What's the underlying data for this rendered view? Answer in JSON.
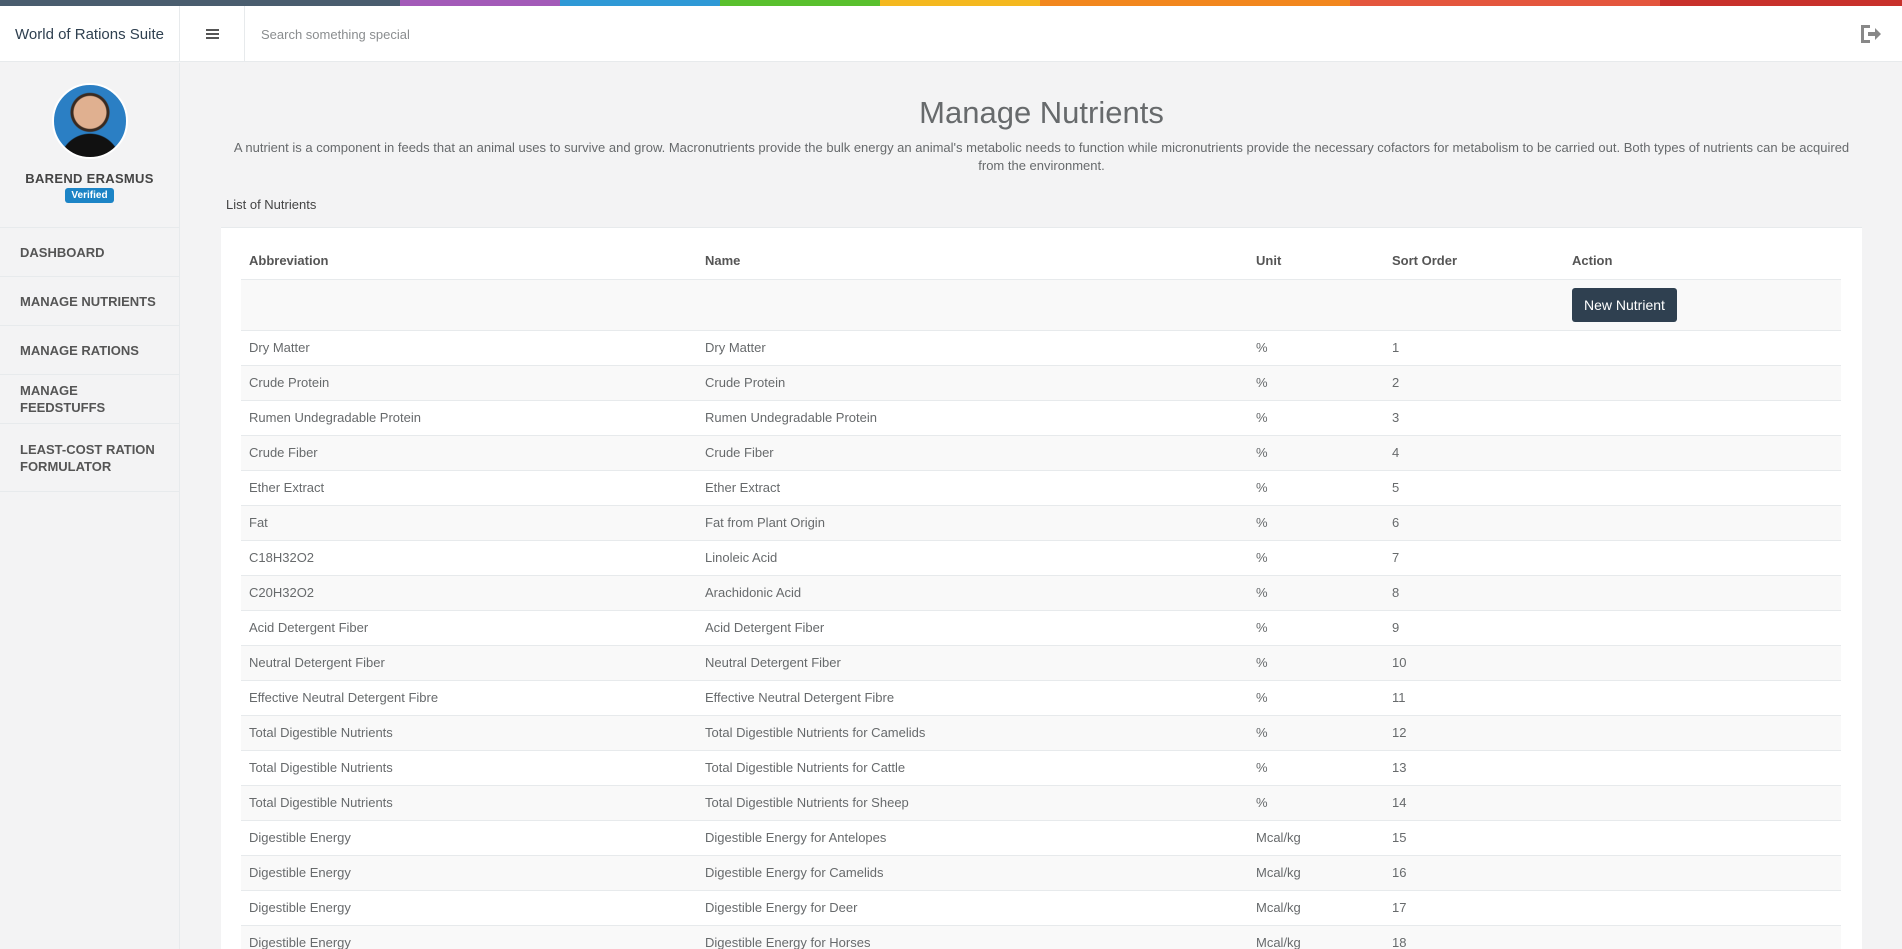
{
  "colorbar": [
    "#4a5d6e",
    "#a35ab8",
    "#2f99d6",
    "#59c02e",
    "#f4b81f",
    "#f2871e",
    "#e4563d",
    "#c8312b"
  ],
  "app": {
    "title": "World of Rations Suite"
  },
  "search": {
    "placeholder": "Search something special"
  },
  "profile": {
    "name": "BAREND ERASMUS",
    "badge": "Verified"
  },
  "nav": [
    {
      "label": "DASHBOARD"
    },
    {
      "label": "MANAGE NUTRIENTS"
    },
    {
      "label": "MANAGE RATIONS"
    },
    {
      "label": "MANAGE FEEDSTUFFS"
    },
    {
      "label": "LEAST-COST RATION FORMULATOR"
    }
  ],
  "page": {
    "title": "Manage Nutrients",
    "description": "A nutrient is a component in feeds that an animal uses to survive and grow. Macronutrients provide the bulk energy an animal's metabolic needs to function while micronutrients provide the necessary cofactors for metabolism to be carried out. Both types of nutrients can be acquired from the environment.",
    "list_label": "List of Nutrients"
  },
  "table": {
    "headers": {
      "abbr": "Abbreviation",
      "name": "Name",
      "unit": "Unit",
      "sort": "Sort Order",
      "action": "Action"
    },
    "new_button": "New Nutrient",
    "rows": [
      {
        "abbr": "Dry Matter",
        "name": "Dry Matter",
        "unit": "%",
        "sort": "1"
      },
      {
        "abbr": "Crude Protein",
        "name": "Crude Protein",
        "unit": "%",
        "sort": "2"
      },
      {
        "abbr": "Rumen Undegradable Protein",
        "name": "Rumen Undegradable Protein",
        "unit": "%",
        "sort": "3"
      },
      {
        "abbr": "Crude Fiber",
        "name": "Crude Fiber",
        "unit": "%",
        "sort": "4"
      },
      {
        "abbr": "Ether Extract",
        "name": "Ether Extract",
        "unit": "%",
        "sort": "5"
      },
      {
        "abbr": "Fat",
        "name": "Fat from Plant Origin",
        "unit": "%",
        "sort": "6"
      },
      {
        "abbr": "C18H32O2",
        "name": "Linoleic Acid",
        "unit": "%",
        "sort": "7"
      },
      {
        "abbr": "C20H32O2",
        "name": "Arachidonic Acid",
        "unit": "%",
        "sort": "8"
      },
      {
        "abbr": "Acid Detergent Fiber",
        "name": "Acid Detergent Fiber",
        "unit": "%",
        "sort": "9"
      },
      {
        "abbr": "Neutral Detergent Fiber",
        "name": "Neutral Detergent Fiber",
        "unit": "%",
        "sort": "10"
      },
      {
        "abbr": "Effective Neutral Detergent Fibre",
        "name": "Effective Neutral Detergent Fibre",
        "unit": "%",
        "sort": "11"
      },
      {
        "abbr": "Total Digestible Nutrients",
        "name": "Total Digestible Nutrients for Camelids",
        "unit": "%",
        "sort": "12"
      },
      {
        "abbr": "Total Digestible Nutrients",
        "name": "Total Digestible Nutrients for Cattle",
        "unit": "%",
        "sort": "13"
      },
      {
        "abbr": "Total Digestible Nutrients",
        "name": "Total Digestible Nutrients for Sheep",
        "unit": "%",
        "sort": "14"
      },
      {
        "abbr": "Digestible Energy",
        "name": "Digestible Energy for Antelopes",
        "unit": "Mcal/kg",
        "sort": "15"
      },
      {
        "abbr": "Digestible Energy",
        "name": "Digestible Energy for Camelids",
        "unit": "Mcal/kg",
        "sort": "16"
      },
      {
        "abbr": "Digestible Energy",
        "name": "Digestible Energy for Deer",
        "unit": "Mcal/kg",
        "sort": "17"
      },
      {
        "abbr": "Digestible Energy",
        "name": "Digestible Energy for Horses",
        "unit": "Mcal/kg",
        "sort": "18"
      }
    ]
  }
}
